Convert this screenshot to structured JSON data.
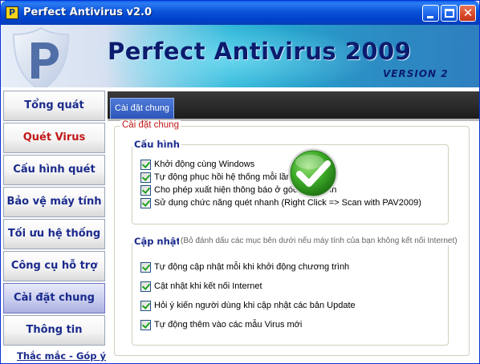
{
  "window": {
    "title": "Perfect Antivirus v2.0",
    "app_icon_letter": "P"
  },
  "banner": {
    "title": "Perfect Antivirus 2009",
    "version": "VERSION 2"
  },
  "sidebar": {
    "items": [
      {
        "label": "Tổng quát"
      },
      {
        "label": "Quét Virus"
      },
      {
        "label": "Cấu hình quét"
      },
      {
        "label": "Bảo vệ máy tính"
      },
      {
        "label": "Tối ưu hệ thống"
      },
      {
        "label": "Công cụ hỗ trợ"
      },
      {
        "label": "Cài đặt chung"
      },
      {
        "label": "Thông tin"
      }
    ],
    "active_index": 6,
    "help_link": "Thắc mắc - Góp ý"
  },
  "main": {
    "tab": "Cài đặt chung",
    "section_title": "Cài đặt chung",
    "groups": [
      {
        "title": "Cấu hình",
        "options": [
          {
            "label": "Khởi động cùng Windows",
            "checked": true
          },
          {
            "label": "Tự động phục hồi hệ thống mỗi lần khởi động",
            "checked": true
          },
          {
            "label": "Cho phép xuất hiện thông báo ở góc màn hình",
            "checked": true
          },
          {
            "label": "Sử dụng chức năng quét nhanh (Right Click => Scan with PAV2009)",
            "checked": true
          }
        ]
      },
      {
        "title": "Cập nhật",
        "note": "(Bỏ đánh dấu các mục bên dưới nếu máy tính của bạn không kết nối Internet)",
        "options": [
          {
            "label": "Tự động cập nhật mỗi khi khởi động chương trình",
            "checked": true
          },
          {
            "label": "Cật nhật khi kết nối Internet",
            "checked": true
          },
          {
            "label": "Hỏi ý kiến người dùng khi cập nhật các bản Update",
            "checked": true
          },
          {
            "label": "Tự động thêm vào các mẫu Virus mới",
            "checked": true
          }
        ]
      }
    ]
  },
  "colors": {
    "nav_text": "#1a2a8c",
    "nav_text_red": "#c01818",
    "section_title": "#c01818",
    "check_green": "#21a121"
  }
}
